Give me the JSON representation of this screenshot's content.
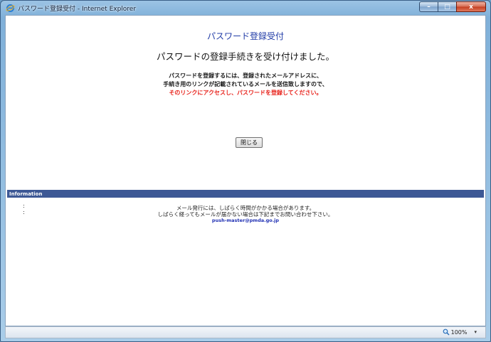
{
  "window": {
    "title": "パスワード登録受付 - Internet Explorer",
    "controls": {
      "minimize": "–",
      "maximize": "□",
      "close": "x"
    }
  },
  "page": {
    "title": "パスワード登録受付",
    "subtitle": "パスワードの登録手続きを受け付けました。",
    "message_lines": [
      "パスワードを登録するには、登録されたメールアドレスに、",
      "手続き用のリンクが記載されているメールを送信致しますので、",
      "そのリンクにアクセスし、パスワードを登録してください。"
    ],
    "close_button_label": "閉じる"
  },
  "information": {
    "header": "Information",
    "bullets": [
      ":",
      ":"
    ],
    "lines": [
      "メール発行には、しばらく時間がかかる場合があります。",
      "しばらく経ってもメールが届かない場合は下記までお問い合わせ下さい。"
    ],
    "email": "push-master@pmda.go.jp"
  },
  "statusbar": {
    "zoom": "100%",
    "zoom_dropdown": "▾"
  },
  "colors": {
    "title_blue": "#1f3aa6",
    "warning_red": "#e8231c",
    "info_bar": "#3d5895",
    "email_blue": "#1f2fb3"
  },
  "icons": {
    "browser": "ie-logo-icon",
    "zoom": "magnifier-icon"
  }
}
